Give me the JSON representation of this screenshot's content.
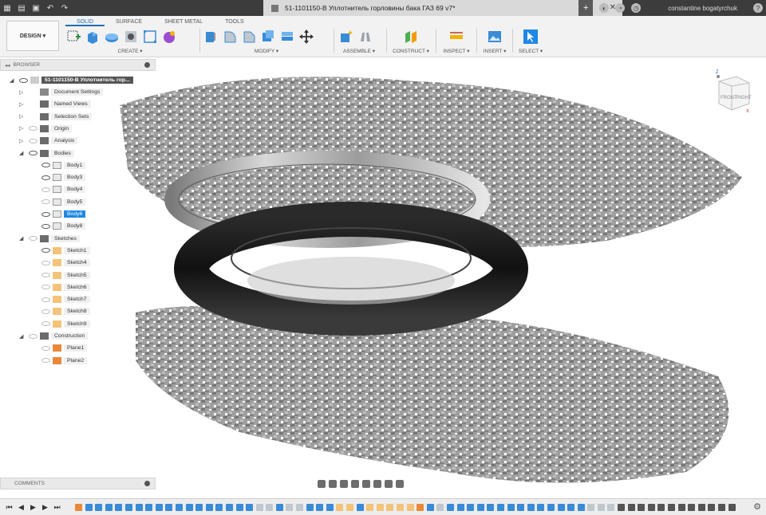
{
  "window": {
    "doc_title": "51-1101150-B Уплотнитель горловины бака ГАЗ 69 v7*",
    "user": "constantine bogatyrchuk"
  },
  "toolbar": {
    "workspace": "DESIGN",
    "tabs": [
      "SOLID",
      "SURFACE",
      "SHEET METAL",
      "TOOLS"
    ],
    "active_tab": "SOLID",
    "groups": {
      "create": "CREATE",
      "modify": "MODIFY",
      "assemble": "ASSEMBLE",
      "construct": "CONSTRUCT",
      "inspect": "INSPECT",
      "insert": "INSERT",
      "select": "SELECT"
    }
  },
  "browser": {
    "title": "BROWSER",
    "root": "51-1101150-B Уплотнитель гор...",
    "items": [
      {
        "label": "Document Settings"
      },
      {
        "label": "Named Views"
      },
      {
        "label": "Selection Sets"
      },
      {
        "label": "Origin"
      },
      {
        "label": "Analysis"
      },
      {
        "label": "Bodies"
      },
      {
        "label": "Body1"
      },
      {
        "label": "Body3"
      },
      {
        "label": "Body4"
      },
      {
        "label": "Body5"
      },
      {
        "label": "Body6"
      },
      {
        "label": "Body8"
      },
      {
        "label": "Sketches"
      },
      {
        "label": "Sketch1"
      },
      {
        "label": "Sketch4"
      },
      {
        "label": "Sketch5"
      },
      {
        "label": "Sketch6"
      },
      {
        "label": "Sketch7"
      },
      {
        "label": "Sketch8"
      },
      {
        "label": "Sketch9"
      },
      {
        "label": "Construction"
      },
      {
        "label": "Plane1"
      },
      {
        "label": "Plane2"
      }
    ]
  },
  "viewcube": {
    "front": "FRONT",
    "right": "RIGHT",
    "axis_z": "Z",
    "axis_x": "X"
  },
  "comments": {
    "title": "COMMENTS"
  },
  "colors": {
    "accent": "#1e88e5",
    "titlebar": "#3c3c3c",
    "ribbon": "#f2f2f2"
  }
}
